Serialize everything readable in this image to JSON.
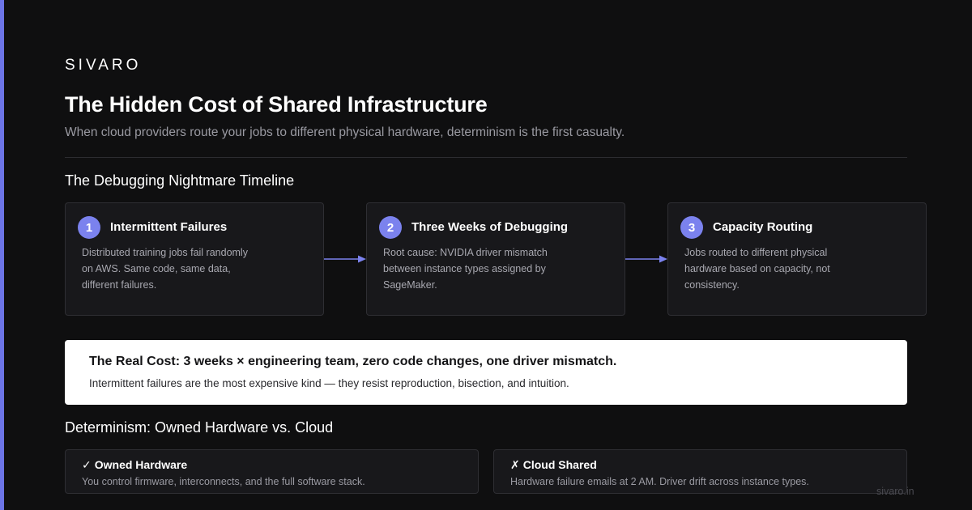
{
  "brand": "SIVARO",
  "header": {
    "title": "The Hidden Cost of Shared Infrastructure",
    "subtitle": "When cloud providers route your jobs to different physical hardware, determinism is the first casualty."
  },
  "timeline": {
    "title": "The Debugging Nightmare Timeline",
    "steps": [
      {
        "number": "1",
        "title": "Intermittent Failures",
        "description": "Distributed training jobs fail randomly on AWS. Same code, same data, different failures."
      },
      {
        "number": "2",
        "title": "Three Weeks of Debugging",
        "description": "Root cause: NVIDIA driver mismatch between instance types assigned by SageMaker."
      },
      {
        "number": "3",
        "title": "Capacity Routing",
        "description": "Jobs routed to different physical hardware based on capacity, not consistency."
      }
    ]
  },
  "callout": {
    "heading": "The Real Cost: 3 weeks × engineering team, zero code changes, one driver mismatch.",
    "body": "Intermittent failures are the most expensive kind — they resist reproduction, bisection, and intuition."
  },
  "comparison": {
    "title": "Determinism: Owned Hardware vs. Cloud",
    "owned": {
      "mark": "✓",
      "title": "Owned Hardware",
      "description": "You control firmware, interconnects, and the full software stack."
    },
    "cloud": {
      "mark": "✗",
      "title": "Cloud Shared",
      "description": "Hardware failure emails at 2 AM. Driver drift across instance types."
    }
  },
  "footer": {
    "url": "sivaro.in"
  },
  "colors": {
    "background": "#0f0f10",
    "accent": "#7b82ee",
    "card": "#18181b",
    "callout": "#ffffff"
  }
}
